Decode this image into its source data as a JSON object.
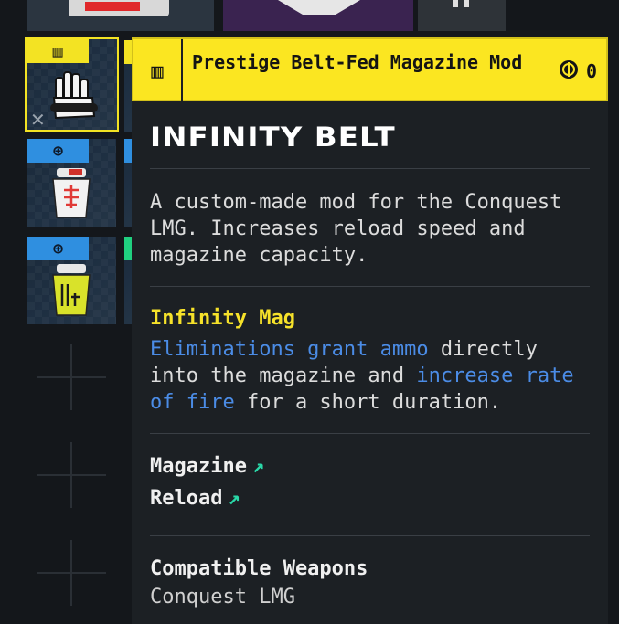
{
  "tooltip": {
    "type_label": "Prestige Belt-Fed Magazine Mod",
    "price": "0",
    "title": "INFINITY BELT",
    "description": "A custom-made mod for the Conquest LMG. Increases reload speed and magazine capacity.",
    "perk": {
      "name": "Infinity Mag",
      "desc_part1": "Eliminations grant ammo",
      "desc_part2": " directly into the magazine and ",
      "desc_part3": "increase rate of fire",
      "desc_part4": " for a short duration."
    },
    "stats": [
      {
        "label": "Magazine"
      },
      {
        "label": "Reload"
      }
    ],
    "arrow": "↗",
    "compatible_label": "Compatible Weapons",
    "compatible_value": "Conquest LMG"
  },
  "slot_badges": {
    "selected": "▥",
    "blue": "⊕"
  },
  "colors": {
    "prestige_yellow": "#fbe621",
    "rarity_blue": "#2f8fe0",
    "highlight_blue": "#4b8ce6",
    "arrow_teal": "#2ad8a8",
    "tooltip_bg": "#1c2024"
  },
  "icons": [
    "chevron-marker-icon",
    "cash-coin-icon",
    "close-icon",
    "hand-mod-icon",
    "figure-mod-icon"
  ]
}
